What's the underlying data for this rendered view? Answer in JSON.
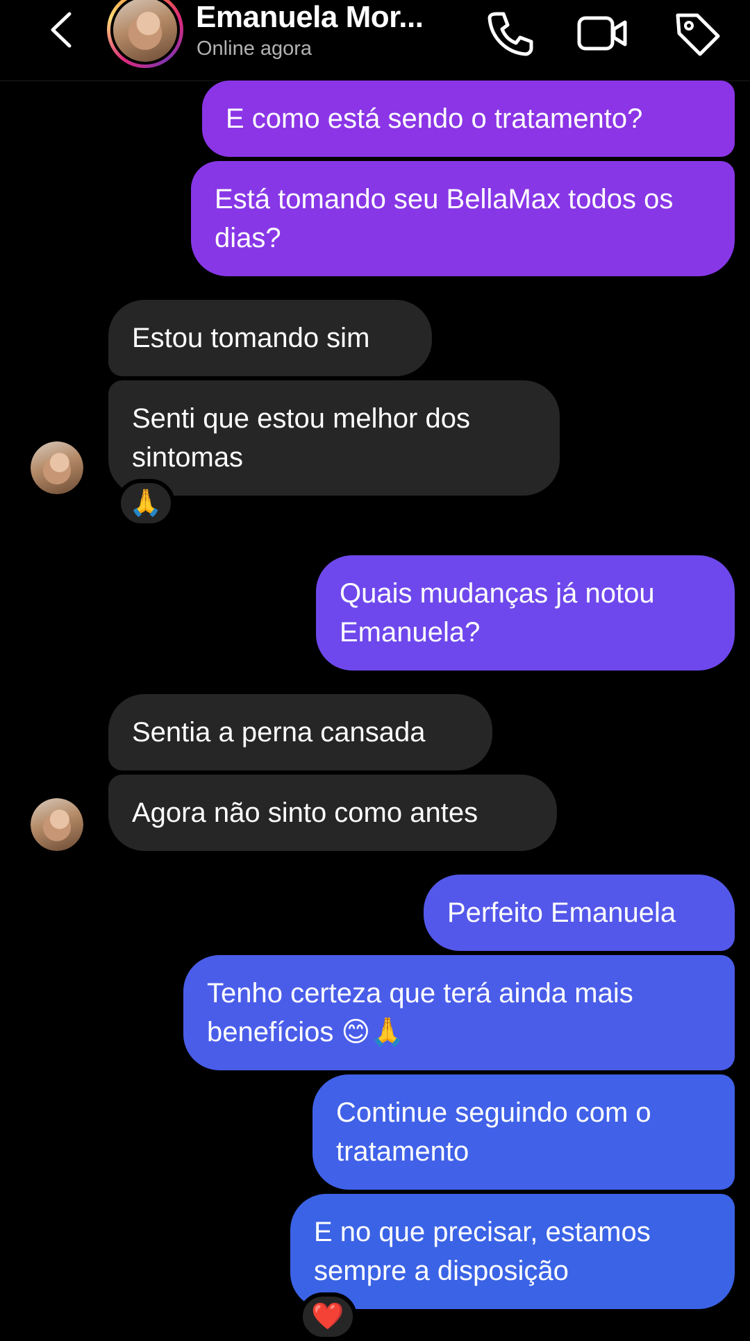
{
  "header": {
    "contact_name": "Emanuela Mor...",
    "status": "Online agora",
    "icons": [
      "back-icon",
      "phone-icon",
      "video-icon",
      "tag-icon"
    ]
  },
  "colors": {
    "background": "#000000",
    "received_bubble": "#262626",
    "sent_gradient_top": "#9333ea",
    "sent_gradient_bottom": "#3b63e6"
  },
  "messages": [
    {
      "from": "me",
      "text": "E como está sendo o tratamento?"
    },
    {
      "from": "me",
      "text": "Está tomando seu BellaMax todos os dias?"
    },
    {
      "from": "them",
      "text": "Estou tomando sim"
    },
    {
      "from": "them",
      "text": "Senti que estou melhor dos sintomas",
      "reaction": "🙏"
    },
    {
      "from": "me",
      "text": "Quais mudanças já notou Emanuela?"
    },
    {
      "from": "them",
      "text": "Sentia a perna cansada"
    },
    {
      "from": "them",
      "text": "Agora não sinto como antes"
    },
    {
      "from": "me",
      "text": "Perfeito Emanuela"
    },
    {
      "from": "me",
      "text": "Tenho certeza que terá ainda mais benefícios 😊🙏"
    },
    {
      "from": "me",
      "text": "Continue seguindo com o tratamento"
    },
    {
      "from": "me",
      "text": "E no que precisar, estamos sempre a disposição",
      "reaction": "❤️"
    }
  ]
}
